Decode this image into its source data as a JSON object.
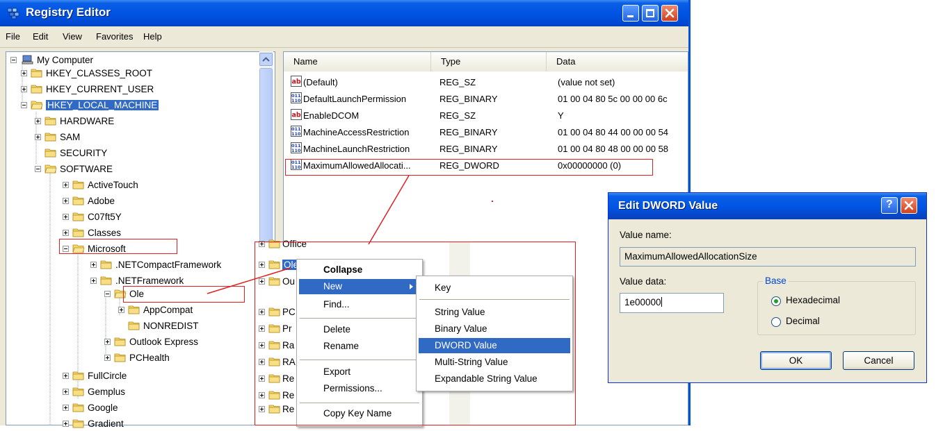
{
  "window": {
    "title": "Registry Editor",
    "menu": [
      "File",
      "Edit",
      "View",
      "Favorites",
      "Help"
    ]
  },
  "tree": {
    "root": "My Computer",
    "items": [
      {
        "label": "HKEY_CLASSES_ROOT"
      },
      {
        "label": "HKEY_CURRENT_USER"
      },
      {
        "label": "HKEY_LOCAL_MACHINE"
      },
      {
        "label": "HARDWARE"
      },
      {
        "label": "SAM"
      },
      {
        "label": "SECURITY"
      },
      {
        "label": "SOFTWARE"
      },
      {
        "label": "ActiveTouch"
      },
      {
        "label": "Adobe"
      },
      {
        "label": "C07ft5Y"
      },
      {
        "label": "Classes"
      },
      {
        "label": "Microsoft"
      },
      {
        "label": ".NETCompactFramework"
      },
      {
        "label": ".NETFramework"
      },
      {
        "label": "Ole"
      },
      {
        "label": "AppCompat"
      },
      {
        "label": "NONREDIST"
      },
      {
        "label": "Outlook Express"
      },
      {
        "label": "PCHealth"
      },
      {
        "label": "FullCircle"
      },
      {
        "label": "Gemplus"
      },
      {
        "label": "Google"
      },
      {
        "label": "Gradient"
      }
    ]
  },
  "list": {
    "columns": [
      "Name",
      "Type",
      "Data"
    ],
    "rows": [
      {
        "name": "(Default)",
        "type": "REG_SZ",
        "data": "(value not set)"
      },
      {
        "name": "DefaultLaunchPermission",
        "type": "REG_BINARY",
        "data": "01 00 04 80 5c 00 00 00 6c"
      },
      {
        "name": "EnableDCOM",
        "type": "REG_SZ",
        "data": "Y"
      },
      {
        "name": "MachineAccessRestriction",
        "type": "REG_BINARY",
        "data": "01 00 04 80 44 00 00 00 54"
      },
      {
        "name": "MachineLaunchRestriction",
        "type": "REG_BINARY",
        "data": "01 00 04 80 48 00 00 00 58"
      },
      {
        "name": "MaximumAllowedAllocati...",
        "type": "REG_DWORD",
        "data": "0x00000000 (0)"
      }
    ]
  },
  "inset_tree": [
    "Office",
    "Ole",
    "Ou",
    "PC",
    "Pr",
    "Ra",
    "RA",
    "Re",
    "Re",
    "Re"
  ],
  "context_menu": {
    "items": [
      "Collapse",
      "New",
      "Find...",
      "Delete",
      "Rename",
      "Export",
      "Permissions...",
      "Copy Key Name"
    ],
    "submenu": [
      "Key",
      "String Value",
      "Binary Value",
      "DWORD Value",
      "Multi-String Value",
      "Expandable String Value"
    ]
  },
  "dialog": {
    "title": "Edit DWORD Value",
    "value_name_label": "Value name:",
    "value_name": "MaximumAllowedAllocationSize",
    "value_data_label": "Value data:",
    "value_data": "1e00000",
    "base_label": "Base",
    "hex_label": "Hexadecimal",
    "dec_label": "Decimal",
    "ok": "OK",
    "cancel": "Cancel",
    "selected_base": "Hexadecimal"
  },
  "colors": {
    "xp_blue": "#0054e3",
    "selection": "#316ac5",
    "annotation_red": "#e02020"
  }
}
